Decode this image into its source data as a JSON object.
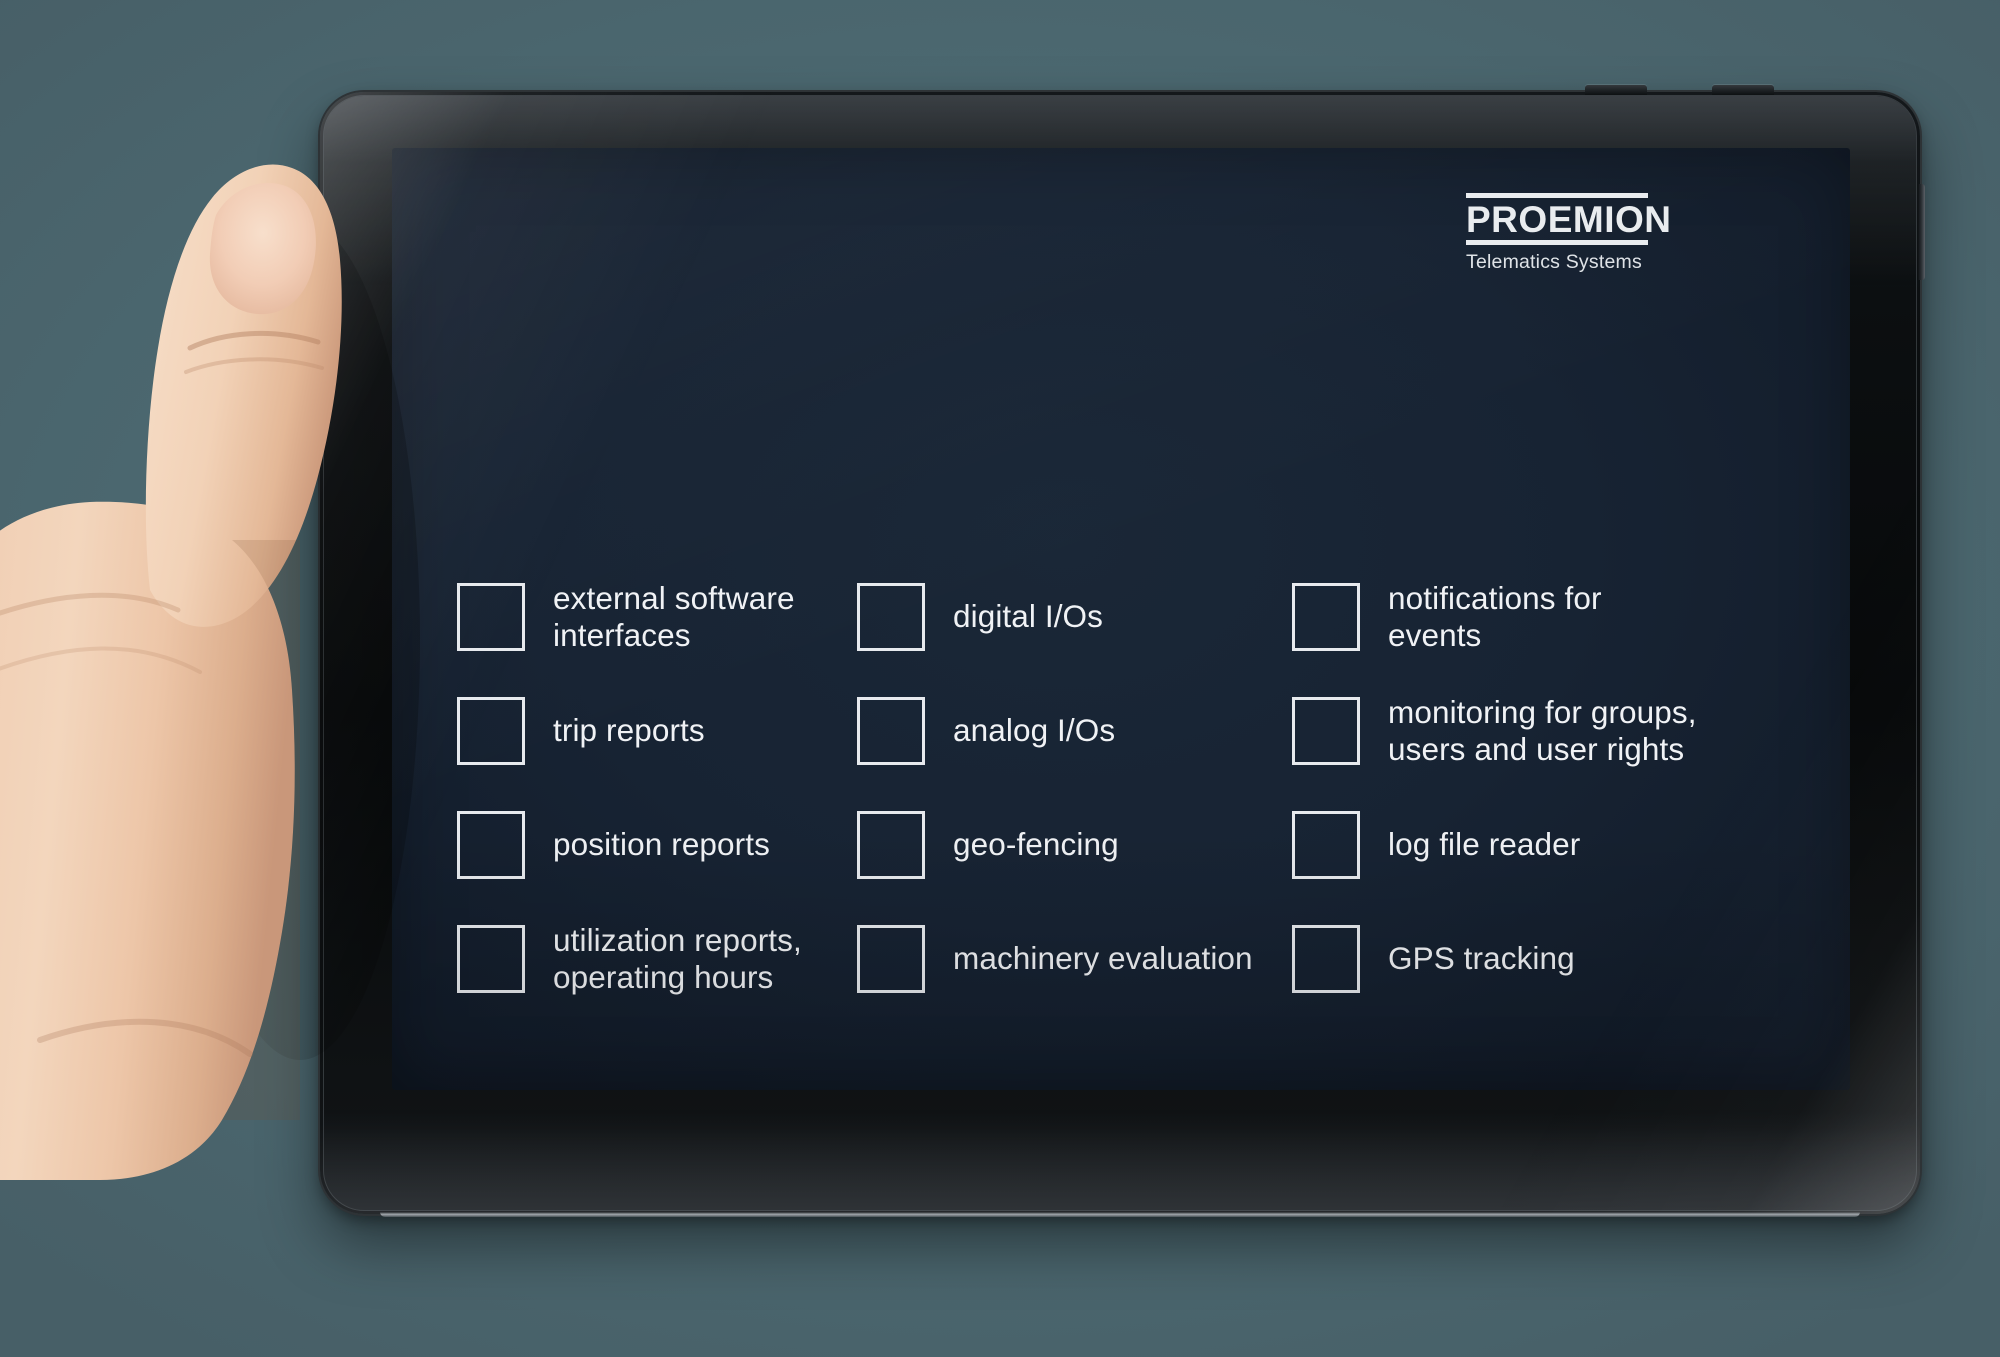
{
  "scene": {
    "device": "tablet",
    "held_by": "left hand",
    "background_color": "#4e6b73"
  },
  "screen": {
    "background_color": "#162433",
    "text_color": "#f0f2f5"
  },
  "logo": {
    "name": "proemion-logo",
    "word_light": "PRO",
    "word_bold": "EMION",
    "tagline": "Telematics Systems",
    "color": "#e9ecef"
  },
  "hardware": {
    "buttons": [
      {
        "name": "volume-button"
      },
      {
        "name": "power-button"
      },
      {
        "name": "side-button"
      }
    ]
  },
  "features": {
    "columns": [
      {
        "name": "feature-column-1",
        "items": [
          {
            "label": "external software\ninterfaces",
            "checked": false
          },
          {
            "label": "trip reports",
            "checked": false
          },
          {
            "label": "position reports",
            "checked": false
          },
          {
            "label": "utilization reports,\noperating hours",
            "checked": false
          }
        ]
      },
      {
        "name": "feature-column-2",
        "items": [
          {
            "label": "digital I/Os",
            "checked": false
          },
          {
            "label": "analog I/Os",
            "checked": false
          },
          {
            "label": "geo-fencing",
            "checked": false
          },
          {
            "label": "machinery evaluation",
            "checked": false
          }
        ]
      },
      {
        "name": "feature-column-3",
        "items": [
          {
            "label": "notifications for\nevents",
            "checked": false
          },
          {
            "label": "monitoring for groups,\nusers and user rights",
            "checked": false
          },
          {
            "label": "log file reader",
            "checked": false
          },
          {
            "label": "GPS tracking",
            "checked": false
          }
        ]
      }
    ]
  }
}
